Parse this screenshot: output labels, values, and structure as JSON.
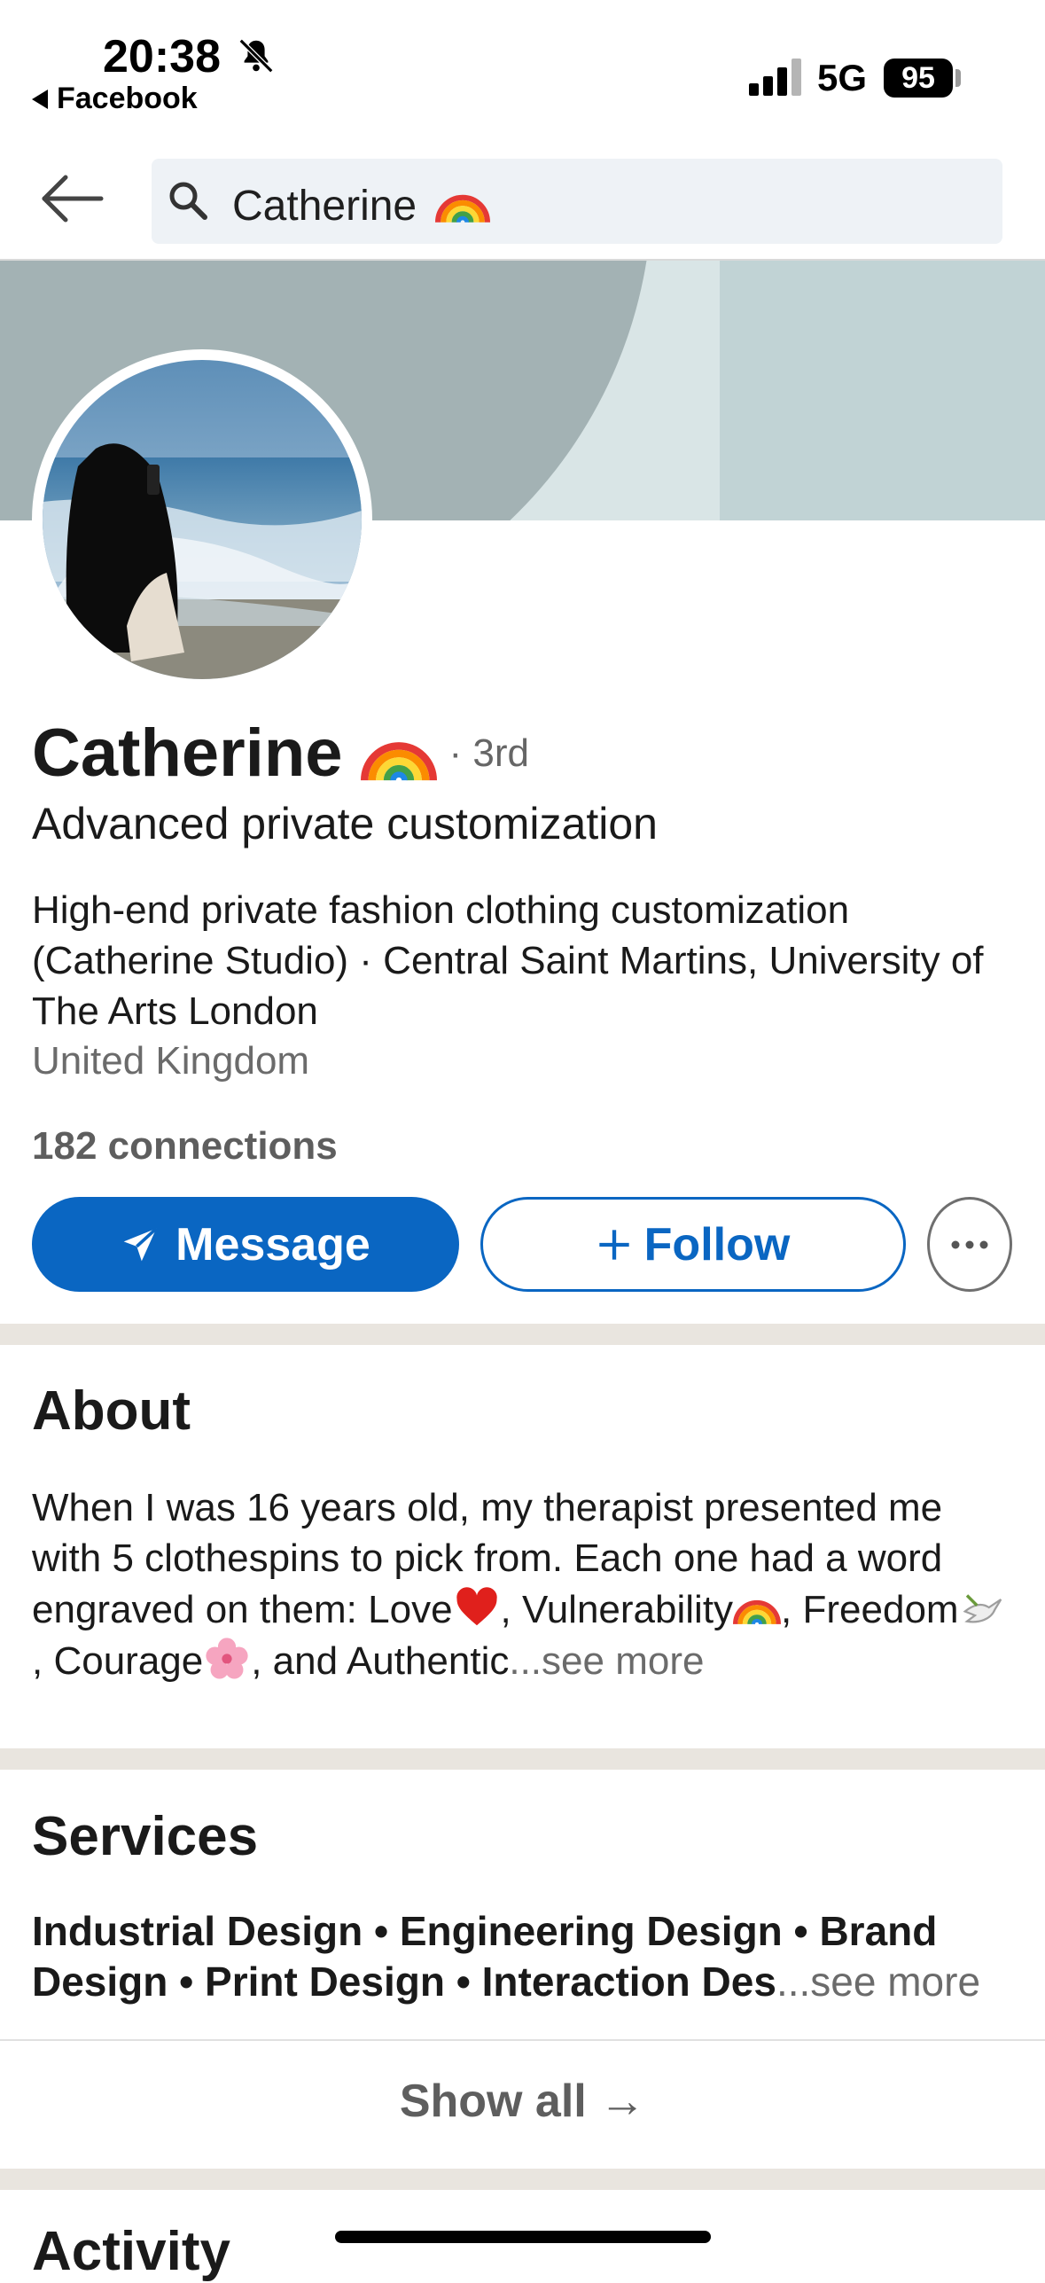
{
  "status_bar": {
    "time": "20:38",
    "back_app": "Facebook",
    "network": "5G",
    "battery": "95"
  },
  "search": {
    "query": "Catherine"
  },
  "profile": {
    "name": "Catherine",
    "degree": "· 3rd",
    "headline": "Advanced private customization",
    "bio": "High-end private fashion clothing customization (Catherine Studio) · Central Saint Martins, University of The Arts London",
    "location": "United Kingdom",
    "connections": "182 connections"
  },
  "actions": {
    "message": "Message",
    "follow": "Follow"
  },
  "about": {
    "title": "About",
    "text_1": "When I was 16 years old, my therapist presented me with 5 clothespins to pick from. Each one had a word engraved on them: Love",
    "text_2": ", Vulnerability",
    "text_3": ", Freedom",
    "text_4": ", Courage",
    "text_5": ", and Authentic",
    "see_more": "...see more"
  },
  "services": {
    "title": "Services",
    "text": "Industrial Design • Engineering Design • Brand Design • Print Design • Interaction Des",
    "see_more": "...see more",
    "show_all": "Show all →"
  },
  "activity": {
    "title": "Activity"
  },
  "colors": {
    "primary": "#0a66c2",
    "section_gap": "#e9e5df",
    "banner": "#c1d3d5"
  }
}
